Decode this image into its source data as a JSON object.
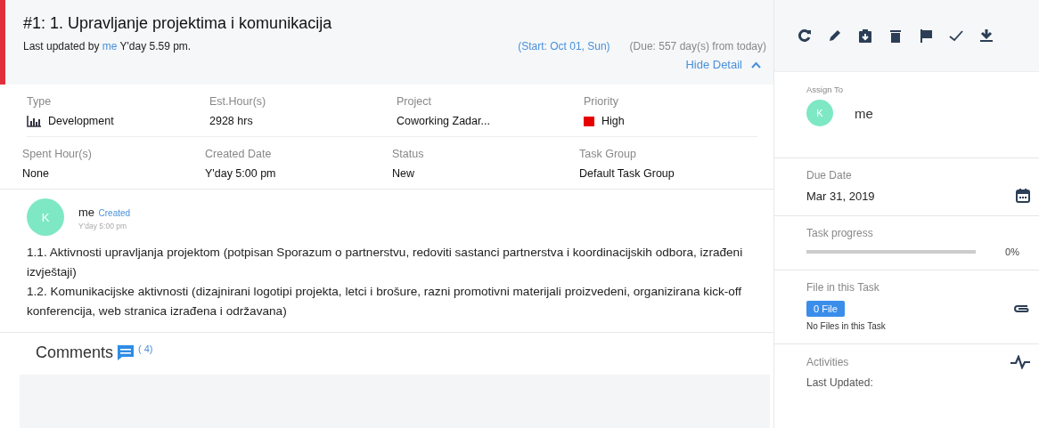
{
  "task": {
    "title": "#1: 1. Upravljanje projektima i komunikacija",
    "updated_prefix": "Last updated by",
    "updated_user": "me",
    "updated_time": "Y'day 5.59 pm.",
    "start": "(Start: Oct 01, Sun)",
    "due": "(Due: 557 day(s) from today)",
    "hide_detail": "Hide Detail"
  },
  "details": [
    {
      "label": "Type",
      "value": "Development",
      "kind": "type"
    },
    {
      "label": "Est.Hour(s)",
      "value": "2928 hrs",
      "kind": "plain"
    },
    {
      "label": "Project",
      "value": "Coworking Zadar...",
      "kind": "plain"
    },
    {
      "label": "Priority",
      "value": "High",
      "kind": "priority",
      "color": "#e60000"
    },
    {
      "label": "Spent Hour(s)",
      "value": "None",
      "kind": "plain"
    },
    {
      "label": "Created Date",
      "value": "Y'day 5:00 pm",
      "kind": "plain"
    },
    {
      "label": "Status",
      "value": "New",
      "kind": "plain"
    },
    {
      "label": "Task Group",
      "value": "Default Task Group",
      "kind": "plain"
    }
  ],
  "activity": {
    "avatar": "K",
    "user": "me",
    "action": "Created",
    "time": "Y'day 5:00 pm",
    "paragraphs": [
      "1.1. Aktivnosti upravljanja projektom (potpisan Sporazum o partnerstvu, redoviti sastanci partnerstva i koordinacijskih odbora, izrađeni izvještaji)",
      "1.2. Komunikacijske aktivnosti (dizajnirani logotipi projekta, letci i brošure, razni promotivni materijali proizvedeni, organizirana kick-off konferencija, web stranica izrađena i održavana)"
    ]
  },
  "comments": {
    "title": "Comments",
    "count": "( 4)"
  },
  "sidebar": {
    "assign_label": "Assign To",
    "assign_avatar": "K",
    "assign_name": "me",
    "due_label": "Due Date",
    "due_value": "Mar 31, 2019",
    "progress_label": "Task progress",
    "progress": {
      "level": 0,
      "reading": "0%"
    },
    "files_label": "File in this Task",
    "files_badge": "0 File",
    "files_empty": "No Files in this Task",
    "activities_label": "Activities",
    "last_updated": "Last Updated:"
  }
}
